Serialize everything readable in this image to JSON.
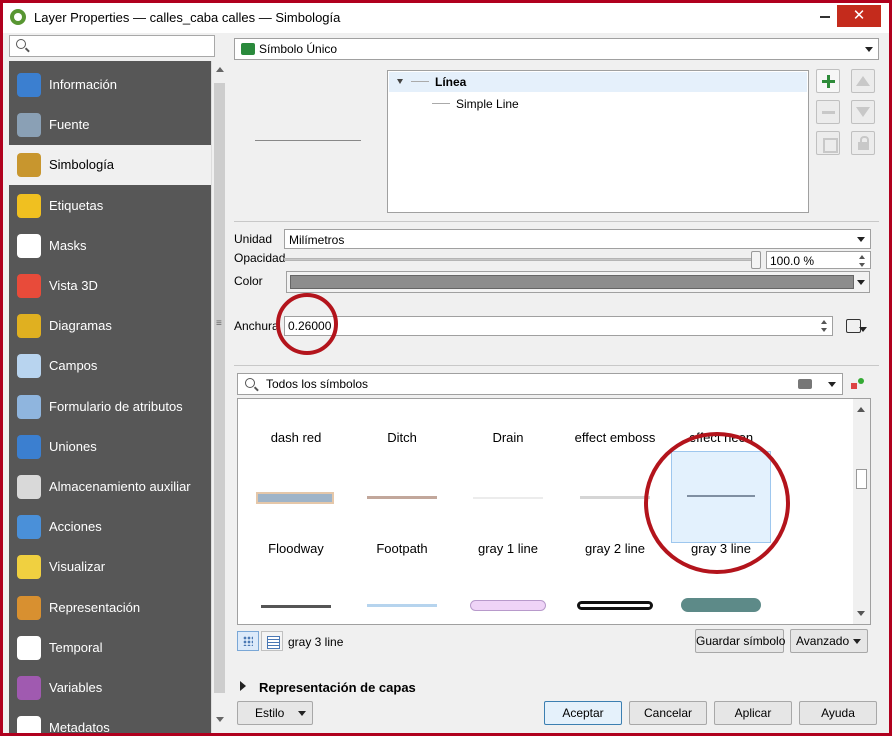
{
  "window": {
    "title": "Layer Properties — calles_caba calles — Simbología",
    "close": "✕"
  },
  "sidebar": {
    "items": [
      {
        "label": "Información",
        "icon": "info-icon",
        "color": "#3b7fd0",
        "active": false
      },
      {
        "label": "Fuente",
        "icon": "tools-icon",
        "color": "#8aa0b5",
        "active": false
      },
      {
        "label": "Simbología",
        "icon": "paint-brush-icon",
        "color": "#c8962e",
        "active": true
      },
      {
        "label": "Etiquetas",
        "icon": "abc-label-icon",
        "color": "#f0c020",
        "active": false
      },
      {
        "label": "Masks",
        "icon": "abc-mask-icon",
        "color": "#ffffff",
        "active": false
      },
      {
        "label": "Vista 3D",
        "icon": "cube-3d-icon",
        "color": "#e84b3a",
        "active": false
      },
      {
        "label": "Diagramas",
        "icon": "diagram-icon",
        "color": "#e0b020",
        "active": false
      },
      {
        "label": "Campos",
        "icon": "fields-table-icon",
        "color": "#b8d4ef",
        "active": false
      },
      {
        "label": "Formulario de atributos",
        "icon": "form-icon",
        "color": "#8fb5de",
        "active": false
      },
      {
        "label": "Uniones",
        "icon": "join-icon",
        "color": "#3b7fd0",
        "active": false
      },
      {
        "label": "Almacenamiento auxiliar",
        "icon": "database-icon",
        "color": "#d9d9d9",
        "active": false
      },
      {
        "label": "Acciones",
        "icon": "actions-gear-icon",
        "color": "#4a90d9",
        "active": false
      },
      {
        "label": "Visualizar",
        "icon": "tooltip-balloon-icon",
        "color": "#f0d040",
        "active": false
      },
      {
        "label": "Representación",
        "icon": "brush-render-icon",
        "color": "#d89030",
        "active": false
      },
      {
        "label": "Temporal",
        "icon": "clock-icon",
        "color": "#ffffff",
        "active": false
      },
      {
        "label": "Variables",
        "icon": "epsilon-icon",
        "color": "#a05ab0",
        "active": false
      },
      {
        "label": "Metadatos",
        "icon": "metadata-pencil-icon",
        "color": "#ffffff",
        "active": false
      }
    ]
  },
  "renderer": {
    "label": "Símbolo Único"
  },
  "layers_tree": {
    "root": "Línea",
    "child": "Simple Line"
  },
  "props": {
    "unit_label": "Unidad",
    "unit_value": "Milímetros",
    "opacity_label": "Opacidad",
    "opacity_value": "100.0 %",
    "opacity_level": 1.0,
    "color_label": "Color",
    "color_value": "#8d8d8d",
    "width_label": "Anchura",
    "width_value": "0.26000"
  },
  "symbols": {
    "search_text": "Todos los símbolos",
    "row1": [
      {
        "name": "dash red",
        "selected": false
      },
      {
        "name": "Ditch",
        "selected": false
      },
      {
        "name": "Drain",
        "selected": false
      },
      {
        "name": "effect emboss",
        "selected": false
      },
      {
        "name": "effect neon",
        "selected": false
      }
    ],
    "row2": [
      {
        "name": "Floodway",
        "selected": false
      },
      {
        "name": "Footpath",
        "selected": false
      },
      {
        "name": "gray 1 line",
        "selected": false
      },
      {
        "name": "gray 2 line",
        "selected": false
      },
      {
        "name": "gray 3 line",
        "selected": true
      }
    ],
    "selected_name": "gray 3 line"
  },
  "buttons": {
    "save_symbol": "Guardar símbolo",
    "advanced": "Avanzado",
    "style": "Estilo",
    "ok": "Aceptar",
    "cancel": "Cancelar",
    "apply": "Aplicar",
    "help": "Ayuda"
  },
  "section": {
    "layer_rendering": "Representación de capas"
  }
}
